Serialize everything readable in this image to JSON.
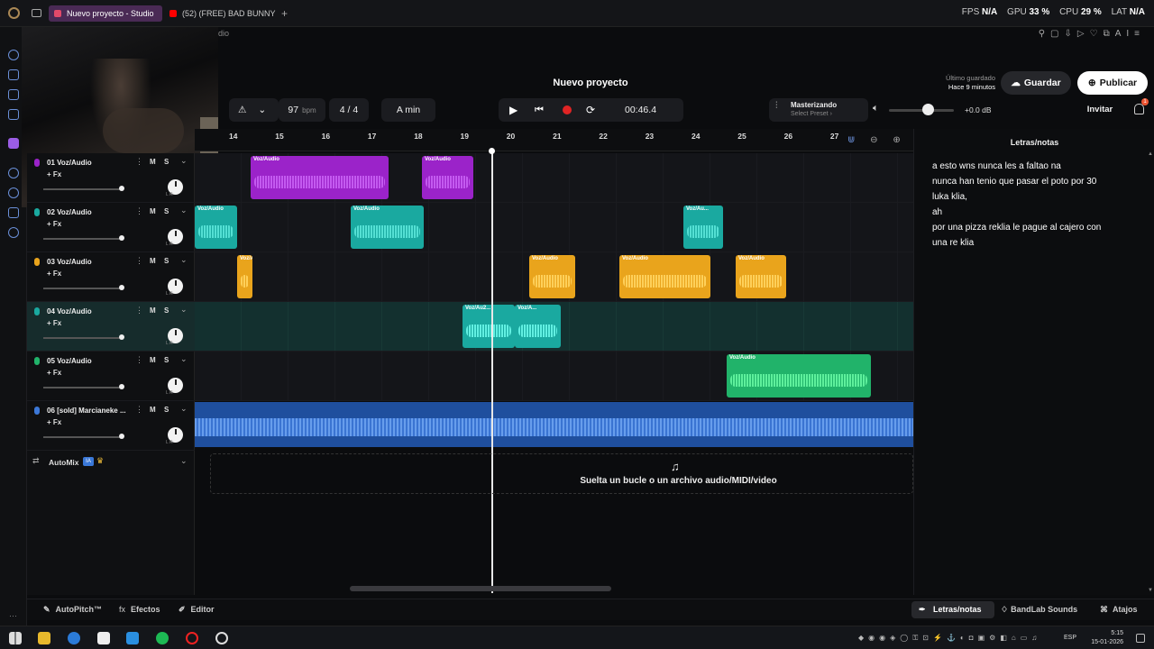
{
  "browser": {
    "tabs": [
      {
        "label": "Nuevo proyecto - Studio",
        "color": "#e24a6a"
      },
      {
        "label": "(52) (FREE) BAD BUNNY ×",
        "color": "#ff0000"
      }
    ],
    "new_tab": "+",
    "stats": {
      "fps_label": "FPS",
      "fps": "N/A",
      "gpu_label": "GPU",
      "gpu": "33 %",
      "cpu_label": "CPU",
      "cpu": "29 %",
      "lat_label": "LAT",
      "lat": "N/A"
    }
  },
  "header": {
    "crumb": "dio",
    "project_title": "Nuevo proyecto",
    "saved_label": "Último guardado",
    "saved_time": "Hace 9 minutos",
    "save_button": "Guardar",
    "publish_button": "Publicar",
    "ai_label": "AI"
  },
  "transport": {
    "bpm": "97",
    "bpm_unit": "bpm",
    "time_signature": "4 / 4",
    "key": "A min",
    "time": "00:46.4",
    "mastering_title": "Masterizando",
    "mastering_preset": "Select Preset ›",
    "volume_db": "+0.0 dB",
    "volume_level": 0.6,
    "invite_button": "Invitar",
    "notification_count": "1"
  },
  "ruler": {
    "ticks": [
      "14",
      "15",
      "16",
      "17",
      "18",
      "19",
      "20",
      "21",
      "22",
      "23",
      "24",
      "25",
      "26",
      "27"
    ]
  },
  "tracks": [
    {
      "number": "01",
      "name": "Voz/Audio",
      "color": "#9b23c9"
    },
    {
      "number": "02",
      "name": "Voz/Audio",
      "color": "#1aa9a0"
    },
    {
      "number": "03",
      "name": "Voz/Audio",
      "color": "#e9a41c"
    },
    {
      "number": "04",
      "name": "Voz/Audio",
      "color": "#1aa9a0"
    },
    {
      "number": "05",
      "name": "Voz/Audio",
      "color": "#21b36a"
    },
    {
      "number": "06",
      "name": "[sold] Marcianeke ...",
      "color": "#3c78d8"
    }
  ],
  "track_controls": {
    "fx": "+ Fx",
    "mute": "M",
    "solo": "S",
    "lr": "L      R"
  },
  "clips": [
    {
      "label": "Voz/Audio"
    },
    {
      "label": "Voz/Audio"
    },
    {
      "label": "Voz/Audio"
    },
    {
      "label": "Voz/Audio"
    },
    {
      "label": "Voz/Au..."
    },
    {
      "label": "Voz/Audio"
    },
    {
      "label": "Voz/Audio"
    },
    {
      "label": "Voz/Audio"
    },
    {
      "label": "Voz/Audio"
    },
    {
      "label": "Voz/Au2..."
    },
    {
      "label": "Voz/A..."
    },
    {
      "label": "Voz/Audio"
    }
  ],
  "automix": {
    "label": "AutoMix",
    "badge": "IA"
  },
  "drop_zone": {
    "text": "Suelta un bucle o un archivo audio/MIDI/video"
  },
  "notes": {
    "title": "Letras/notas",
    "lines": [
      " a esto wns nunca les a faltao na",
      "nunca han tenio que pasar el poto por 30",
      "luka klia,",
      "ah",
      "por una pizza reklia le pague al cajero con",
      "una re klia"
    ]
  },
  "bottom": {
    "autopitch": "AutoPitch™",
    "effects": "Efectos",
    "editor": "Editor",
    "lyrics_tab": "Letras/notas",
    "sounds": "BandLab Sounds",
    "shortcuts": "Atajos"
  },
  "taskbar": {
    "lang": "ESP",
    "time": "5:15",
    "date": "15-01-2026"
  }
}
